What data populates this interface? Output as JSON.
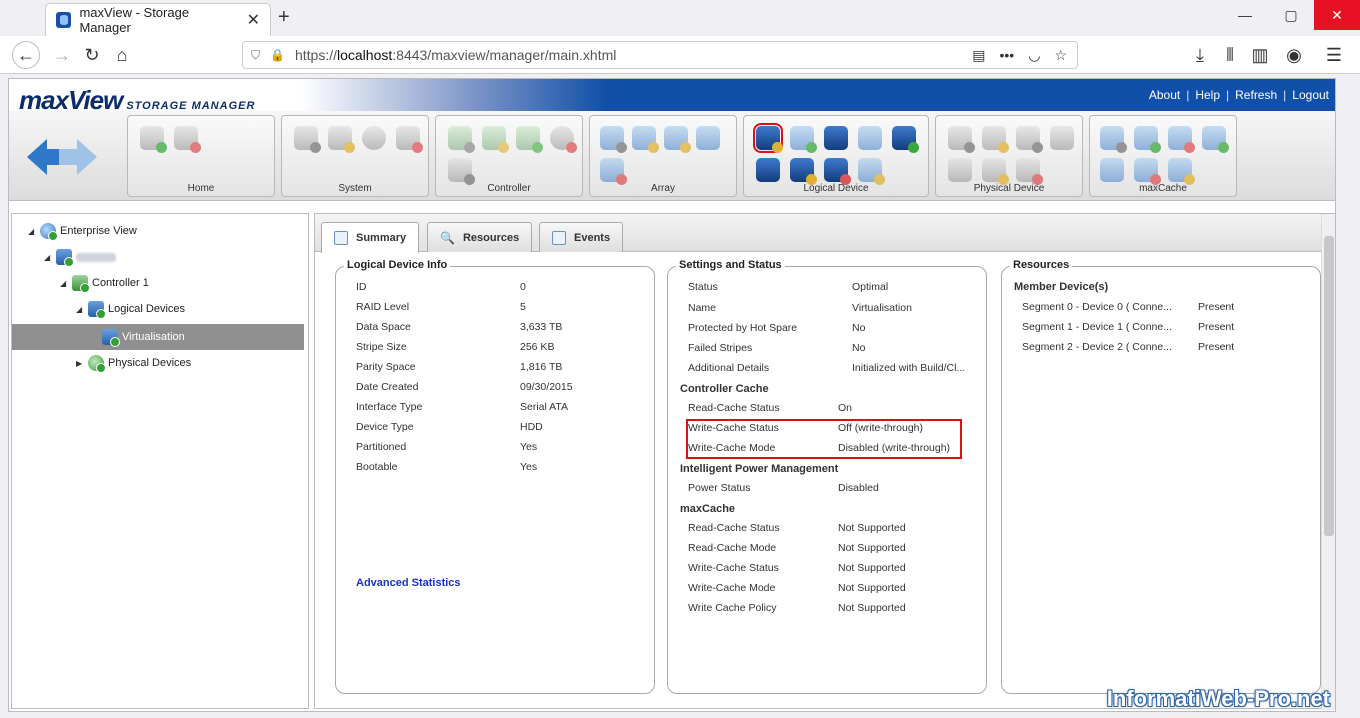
{
  "browser": {
    "tab_title": "maxView - Storage Manager",
    "url_prefix": "https://",
    "url_host": "localhost",
    "url_rest": ":8443/maxview/manager/main.xhtml"
  },
  "app": {
    "logo_main": "maxView",
    "logo_sub": "STORAGE MANAGER",
    "links": [
      "About",
      "Help",
      "Refresh",
      "Logout"
    ]
  },
  "toolbar": {
    "groups": [
      "Home",
      "System",
      "Controller",
      "Array",
      "Logical Device",
      "Physical Device",
      "maxCache"
    ]
  },
  "tree": {
    "root": "Enterprise View",
    "controller": "Controller 1",
    "logical_devices": "Logical Devices",
    "selected": "Virtualisation",
    "physical_devices": "Physical Devices"
  },
  "tabs": [
    "Summary",
    "Resources",
    "Events"
  ],
  "logical_device_info": {
    "title": "Logical Device Info",
    "rows": [
      {
        "k": "ID",
        "v": "0"
      },
      {
        "k": "RAID Level",
        "v": "5"
      },
      {
        "k": "Data Space",
        "v": "3,633 TB"
      },
      {
        "k": "Stripe Size",
        "v": "256 KB"
      },
      {
        "k": "Parity Space",
        "v": "1,816 TB"
      },
      {
        "k": "Date Created",
        "v": "09/30/2015"
      },
      {
        "k": "Interface Type",
        "v": "Serial ATA"
      },
      {
        "k": "Device Type",
        "v": "HDD"
      },
      {
        "k": "Partitioned",
        "v": "Yes"
      },
      {
        "k": "Bootable",
        "v": "Yes"
      }
    ],
    "link": "Advanced Statistics"
  },
  "settings_status": {
    "title": "Settings and Status",
    "rows": [
      {
        "k": "Status",
        "v": "Optimal"
      },
      {
        "k": "Name",
        "v": "Virtualisation"
      },
      {
        "k": "Protected by Hot Spare",
        "v": "No"
      },
      {
        "k": "Failed Stripes",
        "v": "No"
      },
      {
        "k": "Additional Details",
        "v": "Initialized with Build/Cl..."
      }
    ],
    "controller_cache_title": "Controller Cache",
    "controller_cache": [
      {
        "k": "Read-Cache Status",
        "v": "On"
      },
      {
        "k": "Write-Cache Status",
        "v": "Off (write-through)"
      },
      {
        "k": "Write-Cache Mode",
        "v": "Disabled (write-through)"
      }
    ],
    "ipm_title": "Intelligent Power Management",
    "ipm": [
      {
        "k": "Power Status",
        "v": "Disabled"
      }
    ],
    "maxcache_title": "maxCache",
    "maxcache": [
      {
        "k": "Read-Cache Status",
        "v": "Not Supported"
      },
      {
        "k": "Read-Cache Mode",
        "v": "Not Supported"
      },
      {
        "k": "Write-Cache Status",
        "v": "Not Supported"
      },
      {
        "k": "Write-Cache Mode",
        "v": "Not Supported"
      },
      {
        "k": "Write Cache Policy",
        "v": "Not Supported"
      }
    ]
  },
  "resources": {
    "title": "Resources",
    "member_title": "Member Device(s)",
    "rows": [
      {
        "k": "Segment 0 - Device 0 ( Conne...",
        "v": "Present"
      },
      {
        "k": "Segment 1 - Device 1 ( Conne...",
        "v": "Present"
      },
      {
        "k": "Segment 2 - Device 2 ( Conne...",
        "v": "Present"
      }
    ]
  },
  "watermark": "InformatiWeb-Pro.net"
}
